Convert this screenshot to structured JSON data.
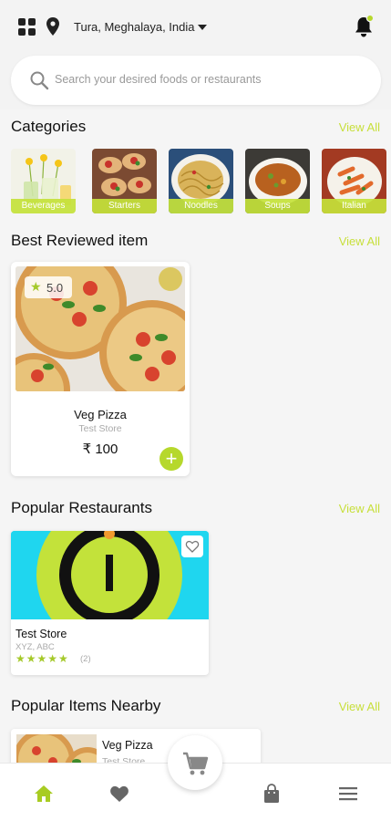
{
  "header": {
    "location": "Tura, Meghalaya, India",
    "grid_icon": "grid-icon",
    "location_icon": "map-pin-icon",
    "notification_icon": "bell-icon"
  },
  "search": {
    "placeholder": "Search your desired foods or restaurants"
  },
  "categories": {
    "title": "Categories",
    "view_all": "View All",
    "items": [
      {
        "label": "Beverages"
      },
      {
        "label": "Starters"
      },
      {
        "label": "Noodles"
      },
      {
        "label": "Soups"
      },
      {
        "label": "Italian"
      }
    ]
  },
  "best_reviewed": {
    "title": "Best Reviewed item",
    "view_all": "View All",
    "item": {
      "rating": "5.0",
      "name": "Veg Pizza",
      "store": "Test Store",
      "price": "₹ 100",
      "add_label": "+"
    }
  },
  "popular_restaurants": {
    "title": "Popular Restaurants",
    "view_all": "View All",
    "item": {
      "name": "Test Store",
      "address": "XYZ, ABC",
      "stars": "★★★★★",
      "rating_count": "(2)"
    }
  },
  "popular_nearby": {
    "title": "Popular Items Nearby",
    "view_all": "View All",
    "item": {
      "name": "Veg Pizza",
      "store": "Test Store"
    }
  },
  "bottom_nav": {
    "items": [
      "home-icon",
      "heart-icon",
      "cart-icon",
      "bag-icon",
      "menu-icon"
    ],
    "active": "home-icon"
  },
  "colors": {
    "accent": "#b6d82c",
    "view_all": "#c7df3a",
    "text": "#111111",
    "muted": "#aaaaaa"
  }
}
